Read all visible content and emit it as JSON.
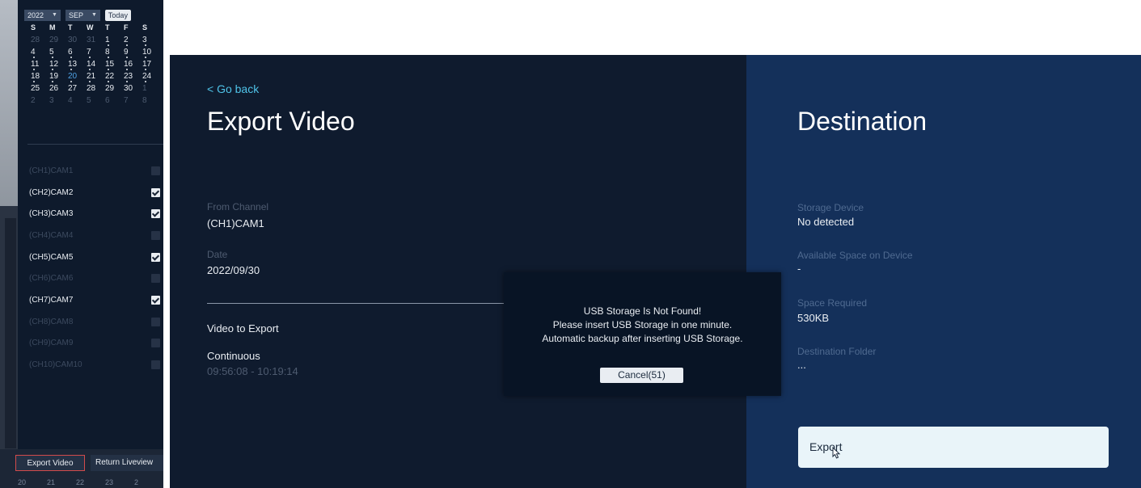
{
  "sidebar": {
    "calendar": {
      "year": "2022",
      "month": "SEP",
      "today_label": "Today",
      "weekdays": [
        "S",
        "M",
        "T",
        "W",
        "T",
        "F",
        "S"
      ],
      "weeks": [
        [
          {
            "d": "28",
            "dim": true
          },
          {
            "d": "29",
            "dim": true
          },
          {
            "d": "30",
            "dim": true
          },
          {
            "d": "31",
            "dim": true
          },
          {
            "d": "1",
            "rec": true
          },
          {
            "d": "2",
            "rec": true
          },
          {
            "d": "3",
            "rec": true
          }
        ],
        [
          {
            "d": "4",
            "rec": true
          },
          {
            "d": "5",
            "rec": true
          },
          {
            "d": "6",
            "rec": true
          },
          {
            "d": "7",
            "rec": true
          },
          {
            "d": "8",
            "rec": true
          },
          {
            "d": "9",
            "rec": true
          },
          {
            "d": "10",
            "rec": true
          }
        ],
        [
          {
            "d": "11",
            "rec": true
          },
          {
            "d": "12",
            "rec": true
          },
          {
            "d": "13",
            "rec": true
          },
          {
            "d": "14",
            "rec": true
          },
          {
            "d": "15",
            "rec": true
          },
          {
            "d": "16",
            "rec": true
          },
          {
            "d": "17",
            "rec": true
          }
        ],
        [
          {
            "d": "18",
            "rec": true
          },
          {
            "d": "19",
            "rec": true
          },
          {
            "d": "20",
            "today": true,
            "rec": true
          },
          {
            "d": "21",
            "rec": true
          },
          {
            "d": "22",
            "rec": true
          },
          {
            "d": "23",
            "rec": true
          },
          {
            "d": "24",
            "rec": true
          }
        ],
        [
          {
            "d": "25"
          },
          {
            "d": "26"
          },
          {
            "d": "27"
          },
          {
            "d": "28"
          },
          {
            "d": "29"
          },
          {
            "d": "30"
          },
          {
            "d": "1",
            "dim": true
          }
        ],
        [
          {
            "d": "2",
            "dim": true
          },
          {
            "d": "3",
            "dim": true
          },
          {
            "d": "4",
            "dim": true
          },
          {
            "d": "5",
            "dim": true
          },
          {
            "d": "6",
            "dim": true
          },
          {
            "d": "7",
            "dim": true
          },
          {
            "d": "8",
            "dim": true
          }
        ]
      ]
    },
    "channels": [
      {
        "label": "(CH1)CAM1",
        "enabled": false,
        "checked": false
      },
      {
        "label": "(CH2)CAM2",
        "enabled": true,
        "checked": true
      },
      {
        "label": "(CH3)CAM3",
        "enabled": true,
        "checked": true
      },
      {
        "label": "(CH4)CAM4",
        "enabled": false,
        "checked": false
      },
      {
        "label": "(CH5)CAM5",
        "enabled": true,
        "checked": true
      },
      {
        "label": "(CH6)CAM6",
        "enabled": false,
        "checked": false
      },
      {
        "label": "(CH7)CAM7",
        "enabled": true,
        "checked": true
      },
      {
        "label": "(CH8)CAM8",
        "enabled": false,
        "checked": false
      },
      {
        "label": "(CH9)CAM9",
        "enabled": false,
        "checked": false
      },
      {
        "label": "(CH10)CAM10",
        "enabled": false,
        "checked": false
      }
    ],
    "export_button": "Export Video",
    "return_button": "Return Liveview",
    "timeline_ticks": [
      "20",
      "21",
      "22",
      "23",
      "2"
    ]
  },
  "main": {
    "go_back": "< Go back",
    "title": "Export Video",
    "from_channel_label": "From Channel",
    "from_channel_value": "(CH1)CAM1",
    "date_label": "Date",
    "date_value": "2022/09/30",
    "video_to_export_label": "Video to Export",
    "mode_value": "Continuous",
    "time_range": "09:56:08 - 10:19:14"
  },
  "destination": {
    "title": "Destination",
    "storage_device_label": "Storage Device",
    "storage_device_value": "No detected",
    "available_space_label": "Available Space on Device",
    "available_space_value": "-",
    "space_required_label": "Space Required",
    "space_required_value": "530KB",
    "destination_folder_label": "Destination Folder",
    "destination_folder_value": "...",
    "export_button": "Export"
  },
  "dialog": {
    "line1": "USB Storage Is Not Found!",
    "line2": "Please insert USB Storage in one minute.",
    "line3": "Automatic backup after inserting USB Storage.",
    "cancel_button": "Cancel(51)"
  },
  "colors": {
    "main_bg": "#0f1b2e",
    "destination_bg": "#14305a",
    "link": "#4fc3e8",
    "today_highlight": "#4fa3e6"
  }
}
